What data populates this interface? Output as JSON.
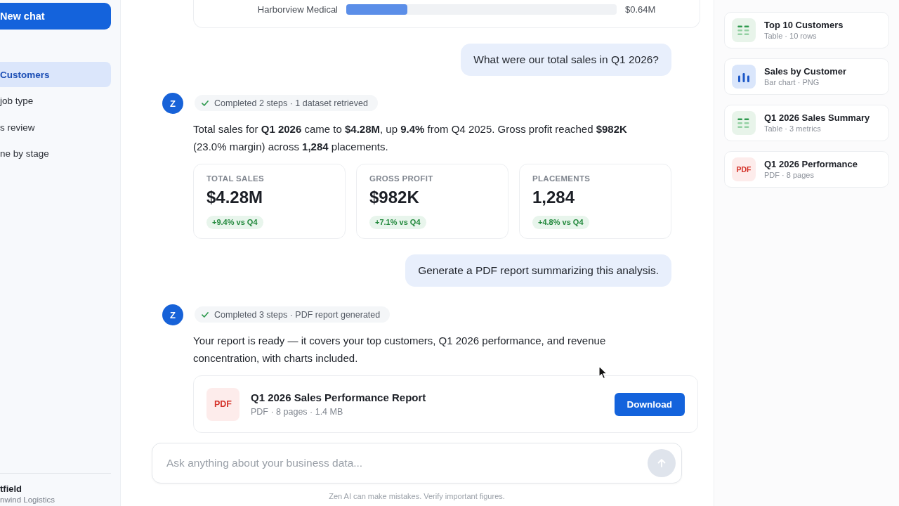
{
  "sidebar": {
    "new_chat": "New chat",
    "items": [
      {
        "label": "Customers",
        "selected": true
      },
      {
        "label": "job type",
        "selected": false
      },
      {
        "label": "s review",
        "selected": false
      },
      {
        "label": "ne by stage",
        "selected": false
      }
    ],
    "user": {
      "name": "tfield",
      "org": "nwind Logistics"
    }
  },
  "chat": {
    "messages": [
      {
        "kind": "chart_tail",
        "bars": [
          {
            "label": "Harborview Medical",
            "level": 0.227,
            "value": "$0.64M"
          }
        ]
      },
      {
        "kind": "user",
        "text": "What were our total sales in Q1 2026?"
      },
      {
        "kind": "assistant",
        "avatar": "Z",
        "status": "Completed 2 steps · 1 dataset retrieved",
        "text": "Total sales for **Q1 2026** came to **$4.28M**, up **9.4%** from Q4 2025. Gross profit reached **$982K** (23.0% margin) across **1,284** placements.",
        "metrics": [
          {
            "label": "TOTAL SALES",
            "value": "$4.28M",
            "change": "+9.4% vs Q4"
          },
          {
            "label": "GROSS PROFIT",
            "value": "$982K",
            "change": "+7.1% vs Q4"
          },
          {
            "label": "PLACEMENTS",
            "value": "1,284",
            "change": "+4.8% vs Q4"
          }
        ]
      },
      {
        "kind": "user",
        "text": "Generate a PDF report summarizing this analysis."
      },
      {
        "kind": "assistant",
        "avatar": "Z",
        "status": "Completed 3 steps · PDF report generated",
        "text": "Your report is ready — it covers your top customers, Q1 2026 performance, and revenue concentration, with charts included.",
        "attachment": {
          "badge": "PDF",
          "title": "Q1 2026 Sales Performance Report",
          "meta": "PDF · 8 pages · 1.4 MB",
          "button": "Download"
        }
      }
    ]
  },
  "composer": {
    "placeholder": "Ask anything about your business data...",
    "send_disabled": true,
    "disclaimer": "Zen AI can make mistakes. Verify important figures."
  },
  "artifacts": [
    {
      "kind": "table",
      "title": "Top 10 Customers",
      "meta": "Table · 10 rows"
    },
    {
      "kind": "chart",
      "title": "Sales by Customer",
      "meta": "Bar chart · PNG"
    },
    {
      "kind": "table",
      "title": "Q1 2026 Sales Summary",
      "meta": "Table · 3 metrics"
    },
    {
      "kind": "pdf",
      "badge": "PDF",
      "title": "Q1 2026 Performance",
      "meta": "PDF · 8 pages"
    }
  ]
}
